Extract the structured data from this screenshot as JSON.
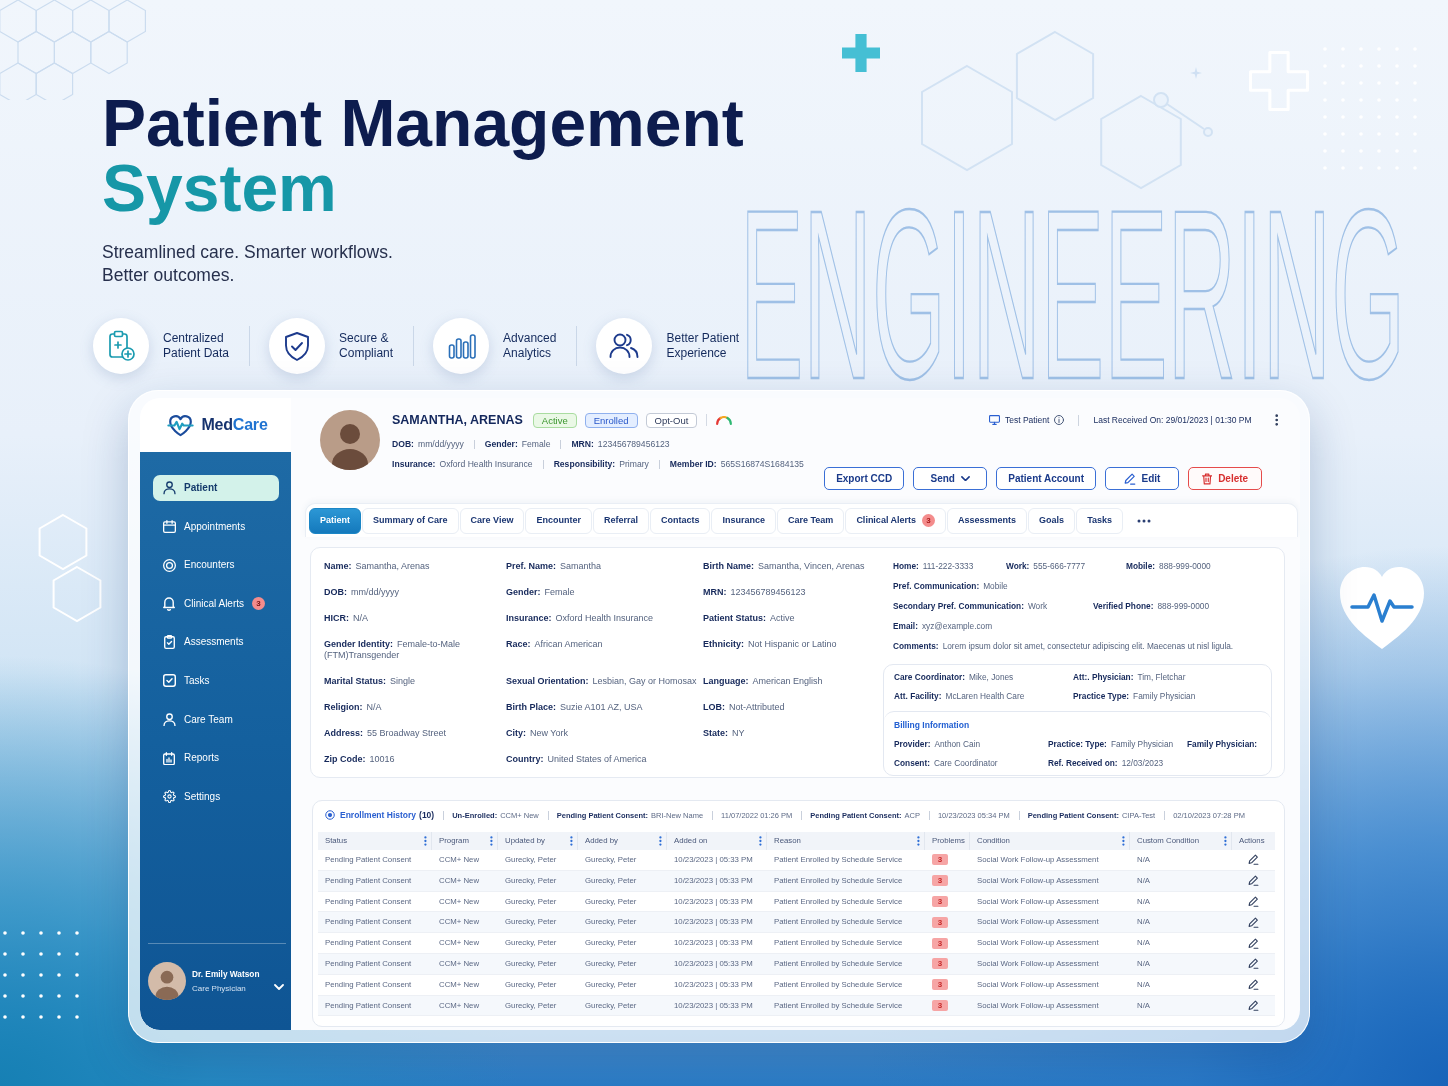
{
  "hero": {
    "title": "Patient Management",
    "title_accent": "System",
    "tagline": "Streamlined care. Smarter workflows. Better outcomes.",
    "backdrop_word": "ENGINEERING"
  },
  "features": [
    {
      "label": [
        "Centralized",
        "Patient Data"
      ]
    },
    {
      "label": [
        "Secure &",
        "Compliant"
      ]
    },
    {
      "label": [
        "Advanced",
        "Analytics"
      ]
    },
    {
      "label": [
        "Better Patient",
        "Experience"
      ]
    }
  ],
  "sidebar": {
    "brand": [
      "Med",
      "Care"
    ],
    "items": [
      {
        "label": "Patient",
        "selected": true
      },
      {
        "label": "Appointments",
        "selected": false
      },
      {
        "label": "Encounters",
        "selected": false
      },
      {
        "label": "Clinical Alerts",
        "selected": false,
        "badge": "3"
      },
      {
        "label": "Assessments",
        "selected": false
      },
      {
        "label": "Tasks",
        "selected": false
      },
      {
        "label": "Care Team",
        "selected": false
      },
      {
        "label": "Reports",
        "selected": false
      },
      {
        "label": "Settings",
        "selected": false
      }
    ],
    "user": {
      "name": "Dr. Emily Watson",
      "role": "Care Physician"
    }
  },
  "patient_header": {
    "name": "SAMANTHA, ARENAS",
    "statuses": [
      {
        "label": "Active",
        "kind": "active"
      },
      {
        "label": "Enrolled",
        "kind": "enrolled"
      },
      {
        "label": "Opt-Out",
        "kind": "neutral"
      }
    ],
    "meta": [
      [
        {
          "label": "DOB:",
          "value": "mm/dd/yyyy"
        },
        {
          "label": "Gender:",
          "value": "Female"
        },
        {
          "label": "MRN:",
          "value": "123456789456123"
        }
      ],
      [
        {
          "label": "Insurance:",
          "value": "Oxford Health Insurance"
        },
        {
          "label": "Responsibility:",
          "value": "Primary"
        },
        {
          "label": "Member ID:",
          "value": "565S16874S1684135"
        }
      ]
    ],
    "test_patient": "Test Patient",
    "last_received": "Last Received On: 29/01/2023 | 01:30 PM",
    "actions": [
      {
        "label": "Export CCD",
        "kind": "plain"
      },
      {
        "label": "Send",
        "kind": "menu"
      },
      {
        "label": "Patient Account",
        "kind": "plain"
      },
      {
        "label": "Edit",
        "kind": "edit"
      },
      {
        "label": "Delete",
        "kind": "delete"
      }
    ]
  },
  "tabs": [
    {
      "label": "Patient",
      "selected": true
    },
    {
      "label": "Summary of Care",
      "selected": false
    },
    {
      "label": "Care View",
      "selected": false
    },
    {
      "label": "Encounter",
      "selected": false
    },
    {
      "label": "Referral",
      "selected": false
    },
    {
      "label": "Contacts",
      "selected": false
    },
    {
      "label": "Insurance",
      "selected": false
    },
    {
      "label": "Care Team",
      "selected": false
    },
    {
      "label": "Clinical Alerts",
      "selected": false,
      "badge": "3"
    },
    {
      "label": "Assessments",
      "selected": false
    },
    {
      "label": "Goals",
      "selected": false
    },
    {
      "label": "Tasks",
      "selected": false
    }
  ],
  "details": {
    "demographics": [
      [
        {
          "label": "Name:",
          "value": "Samantha, Arenas"
        },
        {
          "label": "Pref. Name:",
          "value": "Samantha"
        },
        {
          "label": "Birth Name:",
          "value": "Samantha, Vincen, Arenas"
        }
      ],
      [
        {
          "label": "DOB:",
          "value": "mm/dd/yyyy"
        },
        {
          "label": "Gender:",
          "value": "Female"
        },
        {
          "label": "MRN:",
          "value": "123456789456123"
        }
      ],
      [
        {
          "label": "HICR:",
          "value": "N/A"
        },
        {
          "label": "Insurance:",
          "value": "Oxford Health Insurance"
        },
        {
          "label": "Patient Status:",
          "value": "Active"
        }
      ],
      [
        {
          "label": "Gender Identity:",
          "value": "Female-to-Male (FTM)Transgender"
        },
        {
          "label": "Race:",
          "value": "African American"
        },
        {
          "label": "Ethnicity:",
          "value": "Not Hispanic or Latino"
        }
      ],
      [
        {
          "label": "Marital Status:",
          "value": "Single"
        },
        {
          "label": "Sexual Orientation:",
          "value": "Lesbian, Gay or Homosax"
        },
        {
          "label": "Language:",
          "value": "American English"
        }
      ],
      [
        {
          "label": "Religion:",
          "value": "N/A"
        },
        {
          "label": "Birth Place:",
          "value": "Suzie A101 AZ, USA"
        },
        {
          "label": "LOB:",
          "value": "Not-Attributed"
        }
      ],
      [
        {
          "label": "Address:",
          "value": "55 Broadway Street"
        },
        {
          "label": "City:",
          "value": "New York"
        },
        {
          "label": "State:",
          "value": "NY"
        }
      ],
      [
        {
          "label": "Zip Code:",
          "value": "10016"
        },
        {
          "label": "Country:",
          "value": "United States of America"
        }
      ]
    ],
    "contact": [
      [
        {
          "label": "Home:",
          "value": "111-222-3333"
        },
        {
          "label": "Work:",
          "value": "555-666-7777"
        },
        {
          "label": "Mobile:",
          "value": "888-999-0000"
        }
      ],
      [
        {
          "label": "Pref. Communication:",
          "value": "Mobile"
        }
      ],
      [
        {
          "label": "Secondary Pref. Communication:",
          "value": "Work"
        },
        {
          "label": "Verified Phone:",
          "value": "888-999-0000"
        }
      ],
      [
        {
          "label": "Email:",
          "value": "xyz@example.com"
        }
      ],
      [
        {
          "label": "Comments:",
          "value": "Lorem ipsum dolor sit amet, consectetur adipiscing elit. Maecenas ut nisl ligula."
        }
      ]
    ],
    "care_team": [
      [
        {
          "label": "Care Coordinator:",
          "value": "Mike, Jones"
        },
        {
          "label": "Att:. Physician:",
          "value": "Tim, Fletchar"
        }
      ],
      [
        {
          "label": "Att. Facility:",
          "value": "McLaren Health Care"
        },
        {
          "label": "Practice Type:",
          "value": "Family Physician"
        }
      ]
    ],
    "billing": {
      "title": "Billing Information",
      "rows": [
        [
          {
            "label": "Provider:",
            "value": "Anthon Cain"
          },
          {
            "label": "Practice: Type:",
            "value": "Family Physician"
          },
          {
            "label": "Family Physician:"
          }
        ],
        [
          {
            "label": "Consent:",
            "value": "Care Coordinator"
          },
          {
            "label": "Ref. Received on:",
            "value": "12/03/2023"
          }
        ]
      ]
    }
  },
  "enrollment": {
    "title": "Enrollment History",
    "count": "(10)",
    "summary": [
      {
        "label": "Un-Enrolled:",
        "value": "CCM+ New"
      },
      {
        "label": "Pending Patient Consent:",
        "value": "BRI-New Name"
      },
      {
        "value": "11/07/2022 01:26 PM"
      },
      {
        "label": "Pending Patient Consent:",
        "value": "ACP"
      },
      {
        "value": "10/23/2023 05:34 PM"
      },
      {
        "label": "Pending Patient Consent:",
        "value": "CIPA-Test"
      },
      {
        "value": "02/10/2023 07:28 PM"
      }
    ],
    "columns": [
      {
        "label": "Status",
        "kind": "text",
        "menu": true
      },
      {
        "label": "Program",
        "kind": "text",
        "menu": true
      },
      {
        "label": "Updated by",
        "kind": "text",
        "menu": true
      },
      {
        "label": "Added by",
        "kind": "text",
        "menu": true
      },
      {
        "label": "Added on",
        "kind": "text",
        "menu": true
      },
      {
        "label": "Reason",
        "kind": "text",
        "menu": true
      },
      {
        "label": "Problems",
        "kind": "badge",
        "menu": false
      },
      {
        "label": "Condition",
        "kind": "text",
        "menu": true
      },
      {
        "label": "Custom Condition",
        "kind": "text",
        "menu": true
      },
      {
        "label": "Actions",
        "kind": "action",
        "menu": false
      }
    ],
    "rows": [
      [
        "Pending Patient Consent",
        "CCM+ New",
        "Gurecky, Peter",
        "Gurecky, Peter",
        "10/23/2023 | 05:33 PM",
        "Patient Enrolled by Schedule Service",
        "3",
        "Social Work Follow-up Assessment",
        "N/A"
      ],
      [
        "Pending Patient Consent",
        "CCM+ New",
        "Gurecky, Peter",
        "Gurecky, Peter",
        "10/23/2023 | 05:33 PM",
        "Patient Enrolled by Schedule Service",
        "3",
        "Social Work Follow-up Assessment",
        "N/A"
      ],
      [
        "Pending Patient Consent",
        "CCM+ New",
        "Gurecky, Peter",
        "Gurecky, Peter",
        "10/23/2023 | 05:33 PM",
        "Patient Enrolled by Schedule Service",
        "3",
        "Social Work Follow-up Assessment",
        "N/A"
      ],
      [
        "Pending Patient Consent",
        "CCM+ New",
        "Gurecky, Peter",
        "Gurecky, Peter",
        "10/23/2023 | 05:33 PM",
        "Patient Enrolled by Schedule Service",
        "3",
        "Social Work Follow-up Assessment",
        "N/A"
      ],
      [
        "Pending Patient Consent",
        "CCM+ New",
        "Gurecky, Peter",
        "Gurecky, Peter",
        "10/23/2023 | 05:33 PM",
        "Patient Enrolled by Schedule Service",
        "3",
        "Social Work Follow-up Assessment",
        "N/A"
      ],
      [
        "Pending Patient Consent",
        "CCM+ New",
        "Gurecky, Peter",
        "Gurecky, Peter",
        "10/23/2023 | 05:33 PM",
        "Patient Enrolled by Schedule Service",
        "3",
        "Social Work Follow-up Assessment",
        "N/A"
      ],
      [
        "Pending Patient Consent",
        "CCM+ New",
        "Gurecky, Peter",
        "Gurecky, Peter",
        "10/23/2023 | 05:33 PM",
        "Patient Enrolled by Schedule Service",
        "3",
        "Social Work Follow-up Assessment",
        "N/A"
      ],
      [
        "Pending Patient Consent",
        "CCM+ New",
        "Gurecky, Peter",
        "Gurecky, Peter",
        "10/23/2023 | 05:33 PM",
        "Patient Enrolled by Schedule Service",
        "3",
        "Social Work Follow-up Assessment",
        "N/A"
      ]
    ]
  }
}
